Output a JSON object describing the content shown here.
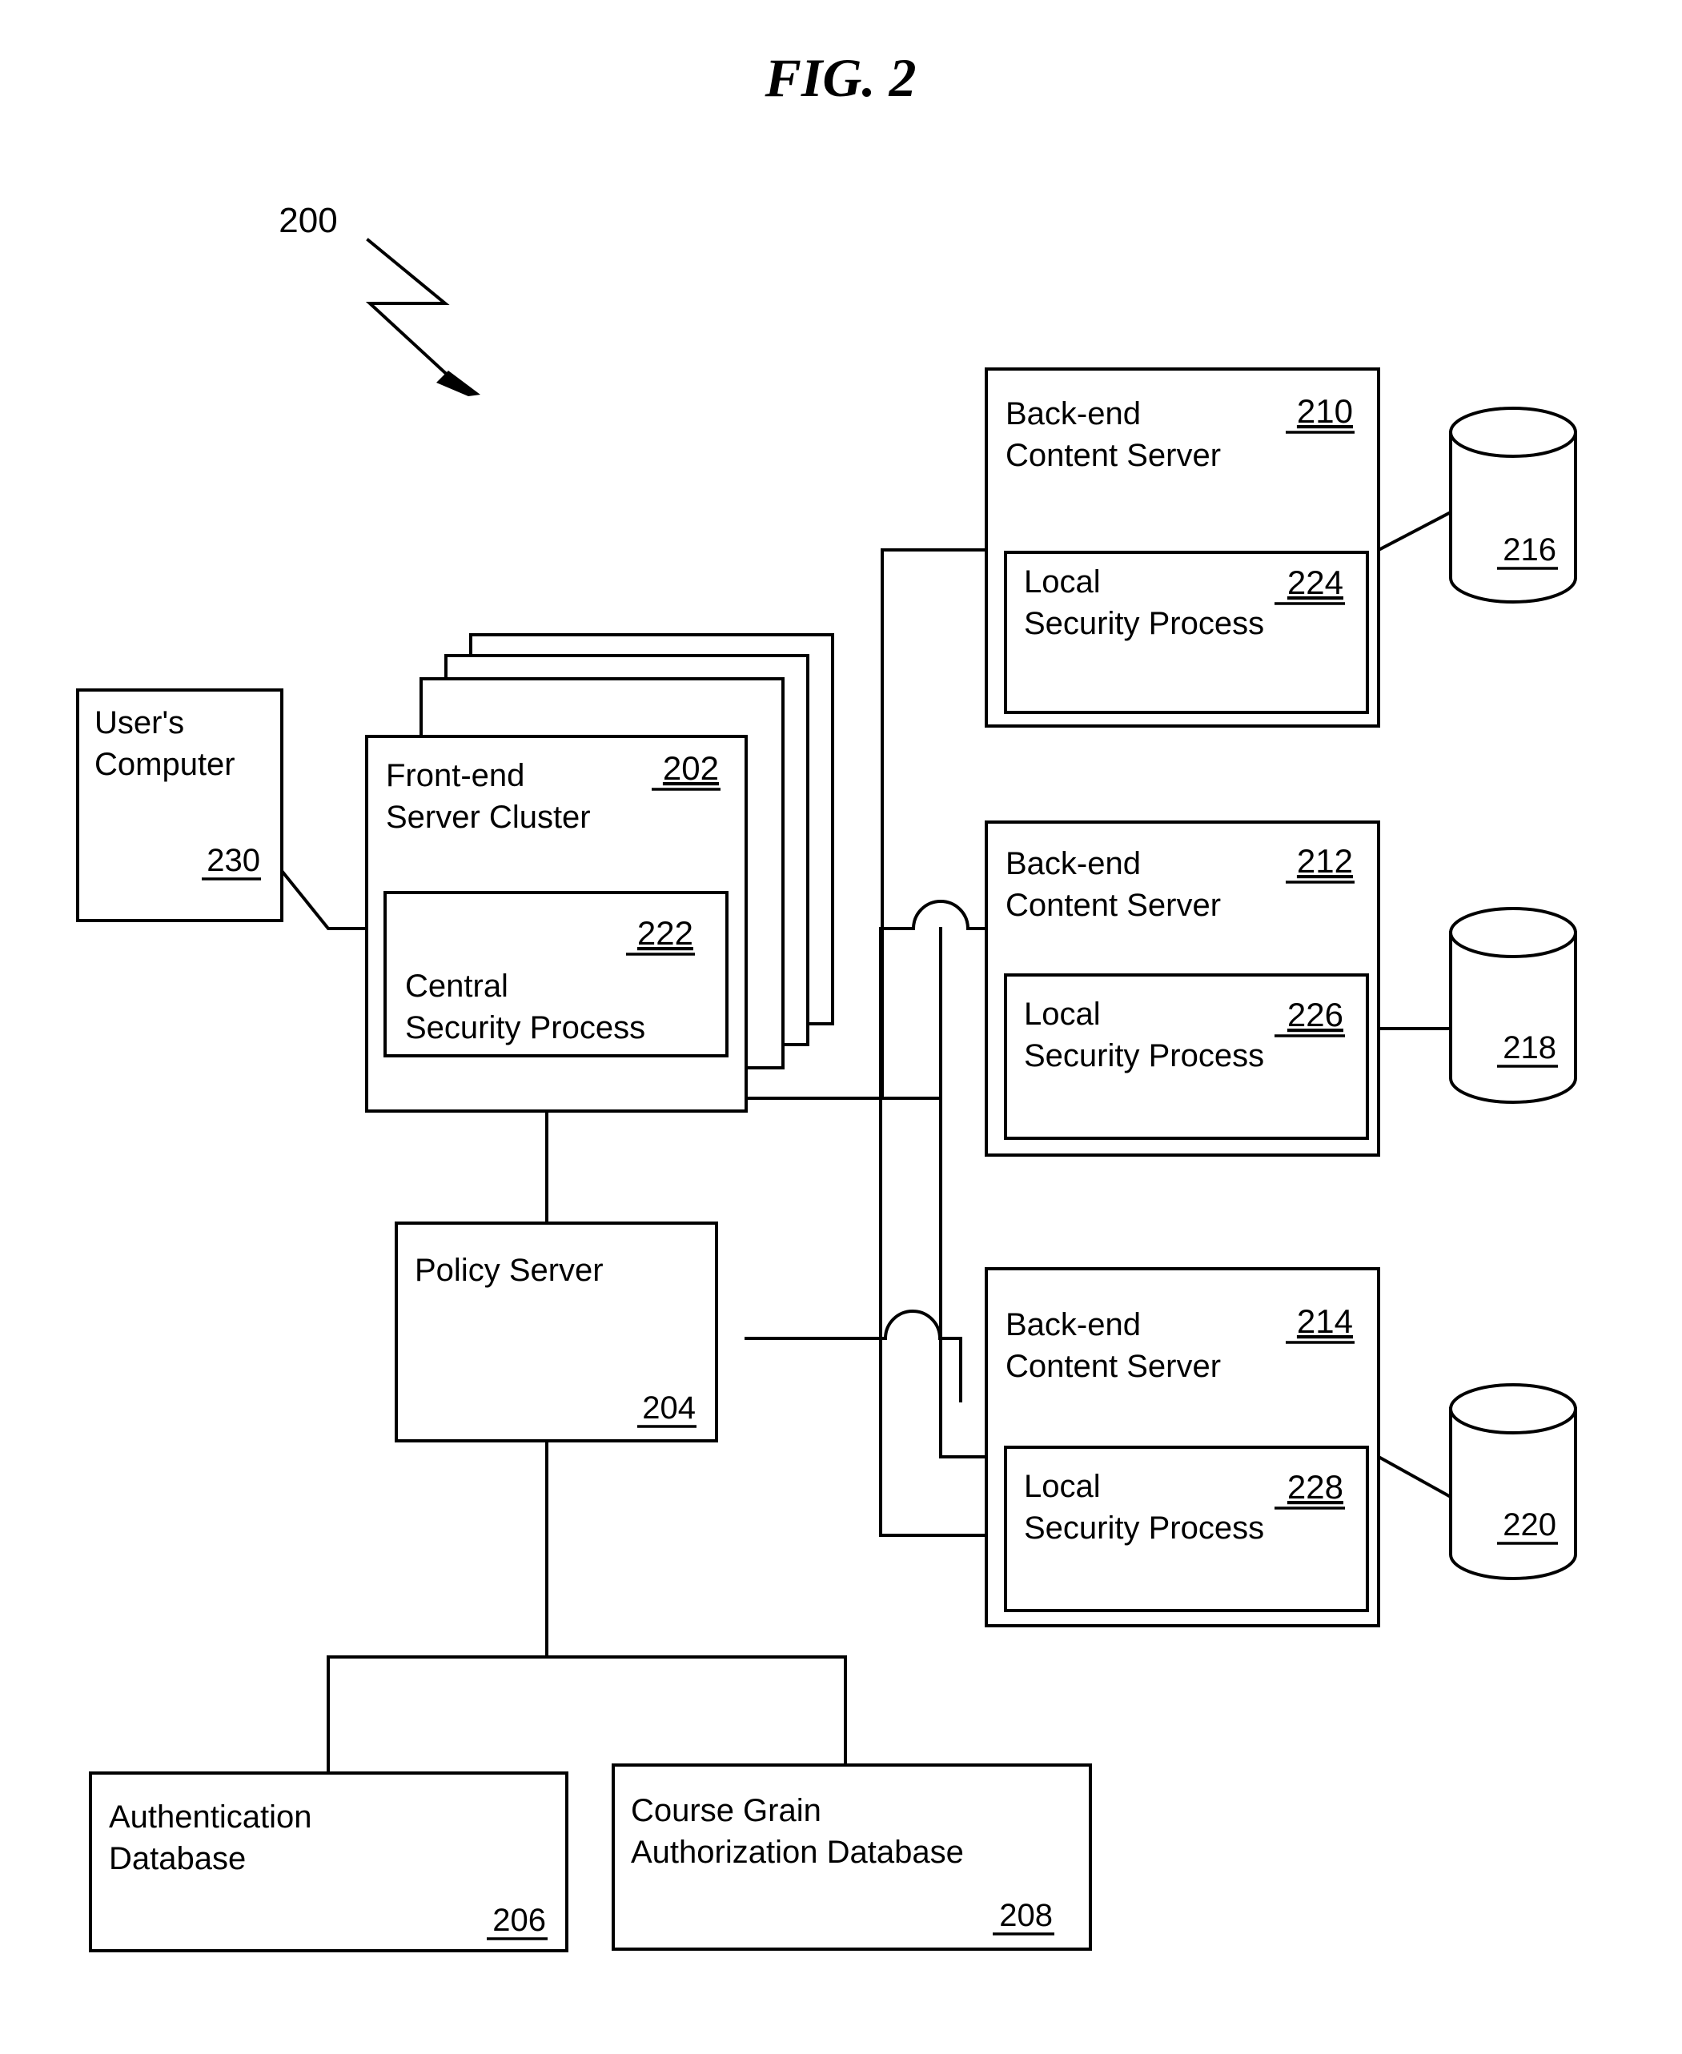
{
  "figure": {
    "title": "FIG. 2",
    "system_ref": "200"
  },
  "nodes": {
    "users_computer": {
      "name": "User's Computer",
      "line1": "User's",
      "line2": "Computer",
      "ref": "230"
    },
    "front_end_cluster": {
      "name": "Front-end Server Cluster",
      "line1": "Front-end",
      "line2": "Server Cluster",
      "ref": "202",
      "inner": {
        "name": "Central Security Process",
        "line1": "Central",
        "line2": "Security Process",
        "ref": "222"
      }
    },
    "policy_server": {
      "name": "Policy Server",
      "line1": "Policy Server",
      "ref": "204"
    },
    "authentication_database": {
      "name": "Authentication Database",
      "line1": "Authentication",
      "line2": "Database",
      "ref": "206"
    },
    "course_grain_authorization_database": {
      "name": "Course Grain Authorization Database",
      "line1": "Course Grain",
      "line2": "Authorization Database",
      "ref": "208"
    },
    "backend_server_1": {
      "name": "Back-end Content Server",
      "line1": "Back-end",
      "line2": "Content Server",
      "ref": "210",
      "inner": {
        "name": "Local Security Process",
        "line1": "Local",
        "line2": "Security Process",
        "ref": "224"
      },
      "storage_ref": "216"
    },
    "backend_server_2": {
      "name": "Back-end Content Server",
      "line1": "Back-end",
      "line2": "Content Server",
      "ref": "212",
      "inner": {
        "name": "Local Security Process",
        "line1": "Local",
        "line2": "Security Process",
        "ref": "226"
      },
      "storage_ref": "218"
    },
    "backend_server_3": {
      "name": "Back-end Content Server",
      "line1": "Back-end",
      "line2": "Content Server",
      "ref": "214",
      "inner": {
        "name": "Local Security Process",
        "line1": "Local",
        "line2": "Security Process",
        "ref": "228"
      },
      "storage_ref": "220"
    }
  },
  "colors": {
    "ink": "#000000",
    "paper": "#ffffff"
  }
}
